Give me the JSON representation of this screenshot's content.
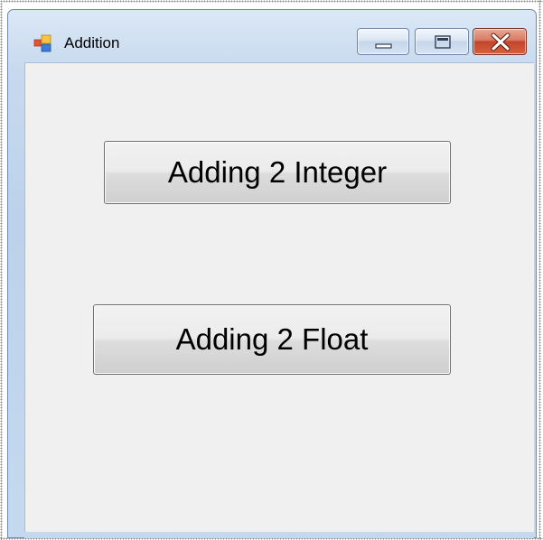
{
  "window": {
    "title": "Addition",
    "app_icon": "winforms-app-icon",
    "caption_buttons": {
      "minimize_icon": "minimize-icon",
      "maximize_icon": "maximize-icon",
      "close_icon": "close-icon"
    }
  },
  "buttons": {
    "add_integer_label": "Adding 2 Integer",
    "add_float_label": "Adding 2 Float"
  },
  "colors": {
    "client_background": "#f0f0f0",
    "frame_blue": "#c5d9ee",
    "close_red": "#c2452b"
  }
}
